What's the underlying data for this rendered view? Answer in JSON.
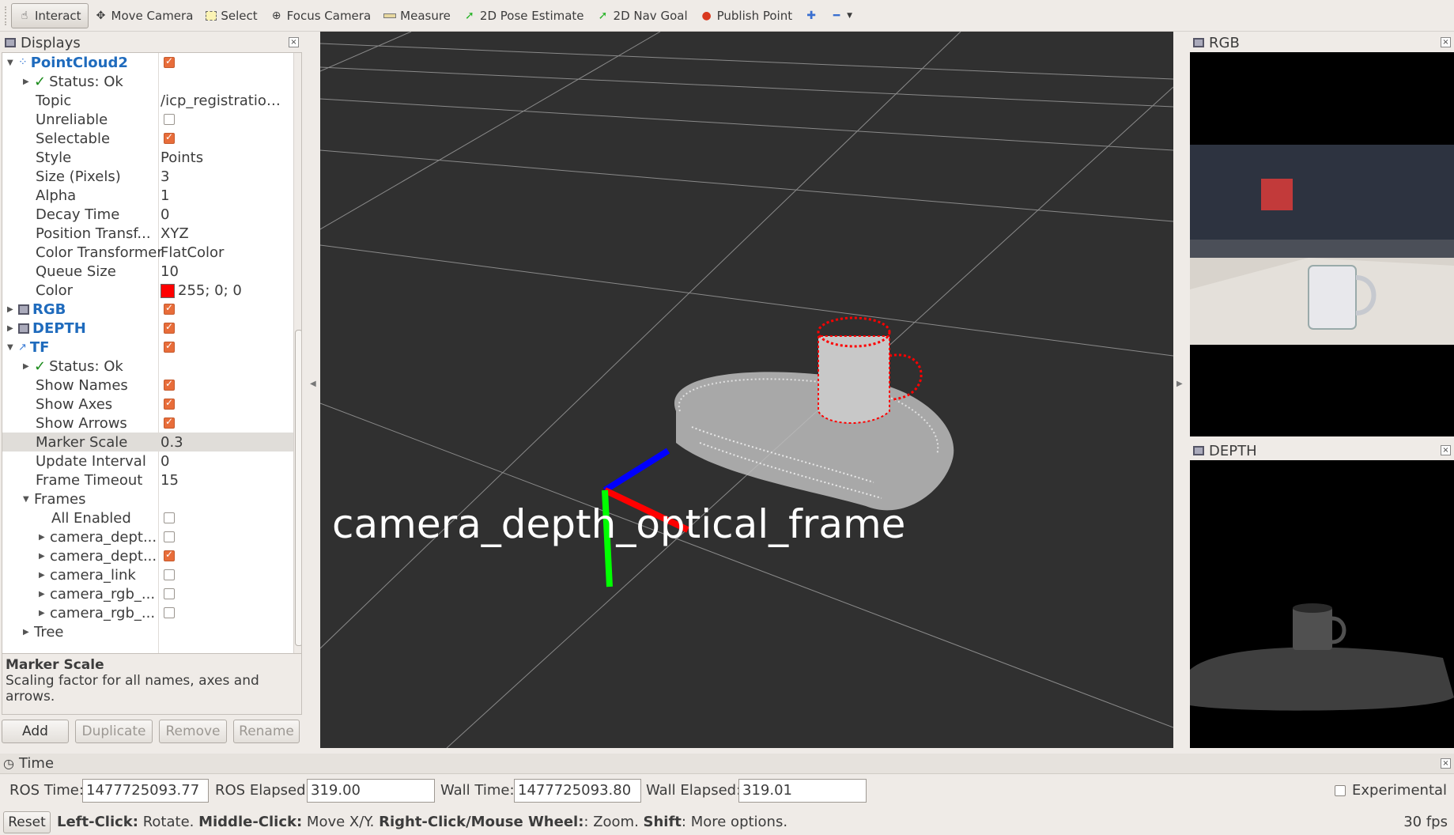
{
  "toolbar": {
    "items": [
      {
        "label": "Interact",
        "icon": "cursor-icon"
      },
      {
        "label": "Move Camera",
        "icon": "move-camera-icon"
      },
      {
        "label": "Select",
        "icon": "select-icon"
      },
      {
        "label": "Focus Camera",
        "icon": "focus-camera-icon"
      },
      {
        "label": "Measure",
        "icon": "measure-icon"
      },
      {
        "label": "2D Pose Estimate",
        "icon": "pose-estimate-icon"
      },
      {
        "label": "2D Nav Goal",
        "icon": "nav-goal-icon"
      },
      {
        "label": "Publish Point",
        "icon": "publish-point-icon"
      }
    ]
  },
  "displays": {
    "title": "Displays",
    "pointcloud": {
      "name": "PointCloud2",
      "status": "Status: Ok",
      "props": [
        {
          "label": "Topic",
          "value": "/icp_registration..."
        },
        {
          "label": "Unreliable",
          "value": ""
        },
        {
          "label": "Selectable",
          "value": ""
        },
        {
          "label": "Style",
          "value": "Points"
        },
        {
          "label": "Size (Pixels)",
          "value": "3"
        },
        {
          "label": "Alpha",
          "value": "1"
        },
        {
          "label": "Decay Time",
          "value": "0"
        },
        {
          "label": "Position Transf...",
          "value": "XYZ"
        },
        {
          "label": "Color Transformer",
          "value": "FlatColor"
        },
        {
          "label": "Queue Size",
          "value": "10"
        },
        {
          "label": "Color",
          "value": "255; 0; 0"
        }
      ]
    },
    "rgb": "RGB",
    "depth": "DEPTH",
    "tf": {
      "name": "TF",
      "status": "Status: Ok",
      "props": [
        {
          "label": "Show Names",
          "value": ""
        },
        {
          "label": "Show Axes",
          "value": ""
        },
        {
          "label": "Show Arrows",
          "value": ""
        },
        {
          "label": "Marker Scale",
          "value": "0.3"
        },
        {
          "label": "Update Interval",
          "value": "0"
        },
        {
          "label": "Frame Timeout",
          "value": "15"
        }
      ],
      "frames": "Frames",
      "all_enabled": "All Enabled",
      "frame_items": [
        "camera_dept...",
        "camera_dept...",
        "camera_link",
        "camera_rgb_...",
        "camera_rgb_..."
      ],
      "tree": "Tree"
    },
    "description": {
      "title": "Marker Scale",
      "text": "Scaling factor for all names, axes and arrows."
    },
    "buttons": {
      "add": "Add",
      "duplicate": "Duplicate",
      "remove": "Remove",
      "rename": "Rename"
    }
  },
  "view3d": {
    "frame_label": "camera_depth_optical_frame",
    "axis_colors": {
      "x": "#ff0000",
      "y": "#00ff00",
      "z": "#0000ff"
    },
    "cloud_color": "#ff0000"
  },
  "rgb_panel": {
    "title": "RGB"
  },
  "depth_panel": {
    "title": "DEPTH"
  },
  "time": {
    "title": "Time",
    "ros_time_label": "ROS Time:",
    "ros_time": "1477725093.77",
    "ros_elapsed_label": "ROS Elapsed:",
    "ros_elapsed": "319.00",
    "wall_time_label": "Wall Time:",
    "wall_time": "1477725093.80",
    "wall_elapsed_label": "Wall Elapsed:",
    "wall_elapsed": "319.01",
    "experimental": "Experimental"
  },
  "status": {
    "reset": "Reset",
    "left_click": "Left-Click:",
    "left_click_text": " Rotate. ",
    "middle_click": "Middle-Click:",
    "middle_click_text": " Move X/Y. ",
    "right_click": "Right-Click/Mouse Wheel:",
    "right_click_text": ": Zoom. ",
    "shift": "Shift",
    "shift_text": ": More options.",
    "fps": "30 fps"
  }
}
